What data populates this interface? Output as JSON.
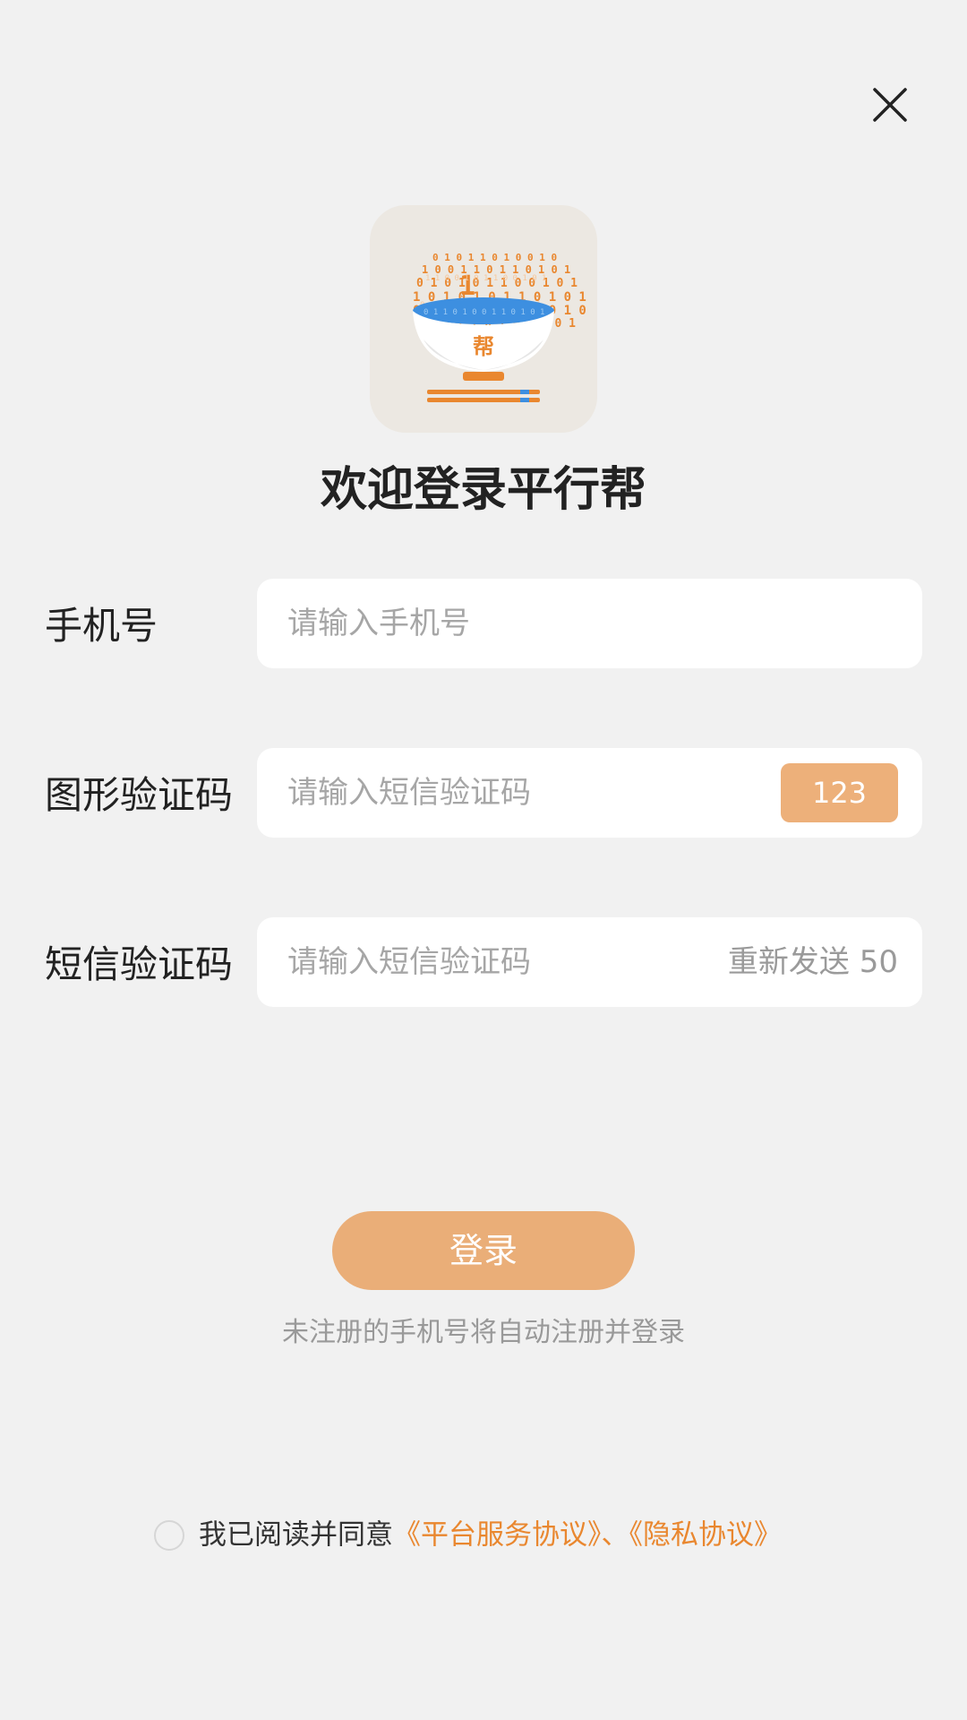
{
  "header": {
    "close_icon": "close-icon"
  },
  "logo": {
    "icon": "bowl-logo-icon",
    "text": "帮",
    "colors": {
      "accent": "#e9872f",
      "blue": "#3d8fe0"
    }
  },
  "welcome": {
    "title": "欢迎登录平行帮"
  },
  "form": {
    "phone": {
      "label": "手机号",
      "placeholder": "请输入手机号",
      "value": ""
    },
    "captcha": {
      "label": "图形验证码",
      "placeholder": "请输入短信验证码",
      "value": "",
      "image_text": "123"
    },
    "sms": {
      "label": "短信验证码",
      "placeholder": "请输入短信验证码",
      "value": "",
      "resend_label": "重新发送 50"
    }
  },
  "login": {
    "button_label": "登录",
    "hint": "未注册的手机号将自动注册并登录"
  },
  "agreement": {
    "checked": false,
    "text": "我已阅读并同意",
    "link_service": "《平台服务协议》",
    "separator": "、",
    "link_privacy": "《隐私协议》"
  },
  "colors": {
    "background": "#f1f1f1",
    "primary_button": "#eaae78",
    "captcha_button": "#edb07a",
    "link": "#e9872f"
  }
}
